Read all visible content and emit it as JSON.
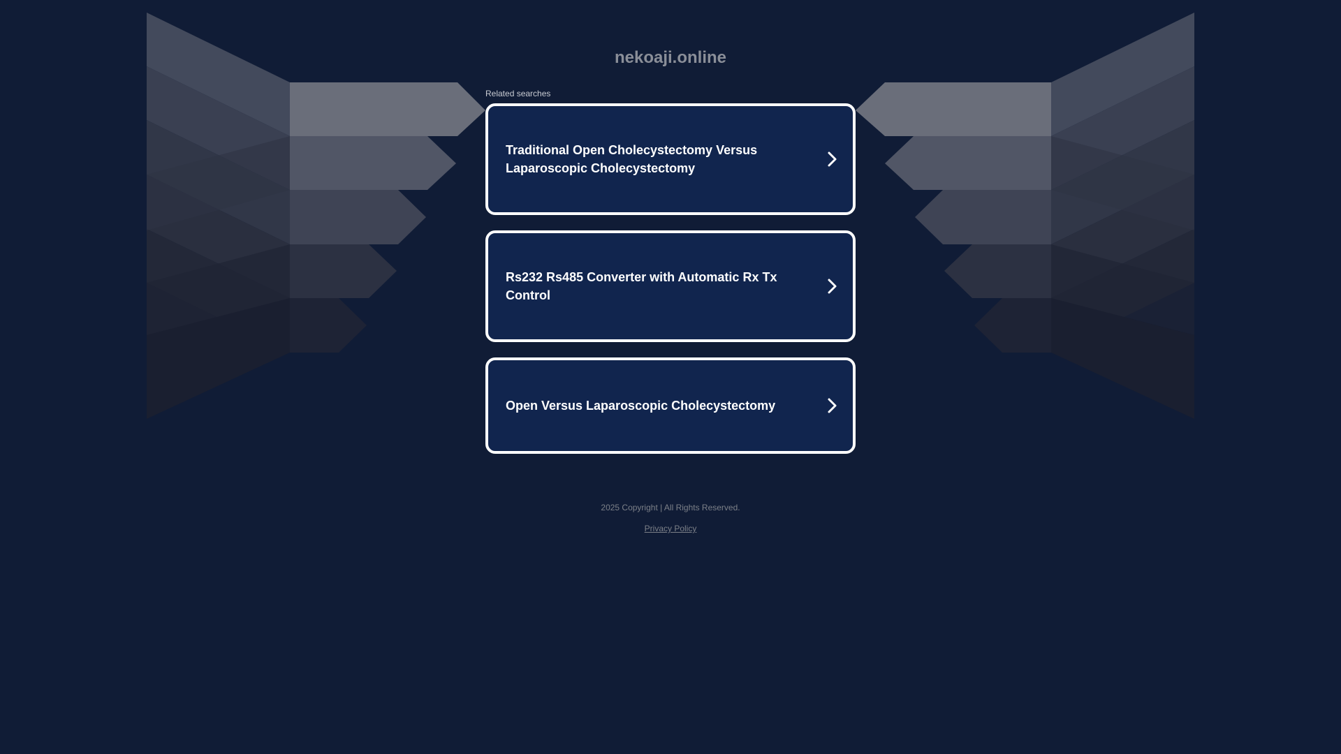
{
  "site": {
    "domain": "nekoaji.online"
  },
  "related": {
    "label": "Related searches",
    "items": [
      {
        "label": "Traditional Open Cholecystectomy Versus Laparoscopic Cholecystectomy"
      },
      {
        "label": "Rs232 Rs485 Converter with Automatic Rx Tx Control"
      },
      {
        "label": "Open Versus Laparoscopic Cholecystectomy"
      }
    ]
  },
  "footer": {
    "copyright": "2025 Copyright | All Rights Reserved.",
    "privacy_label": "Privacy Policy"
  },
  "colors": {
    "background": "#101c36",
    "card_fill": "#11254e",
    "card_border": "#ffffff"
  },
  "icons": {
    "card_arrow": "chevron-right-icon"
  }
}
